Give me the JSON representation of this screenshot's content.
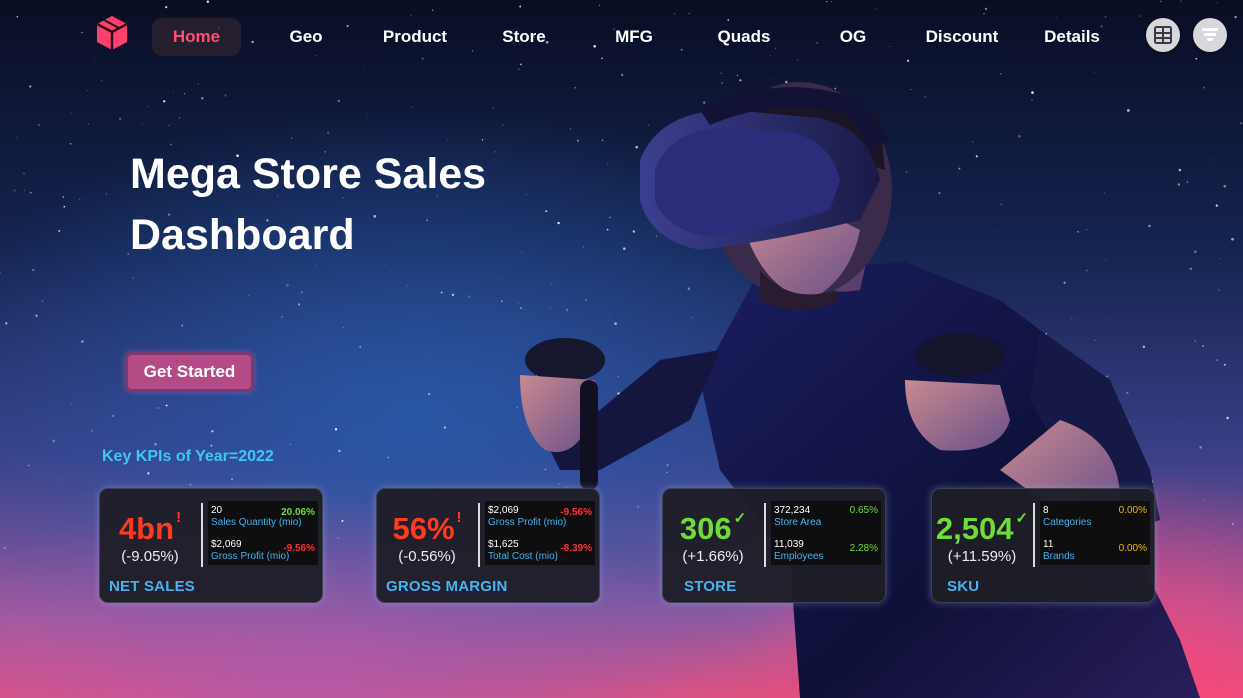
{
  "nav": {
    "items": [
      {
        "label": "Home",
        "active": true
      },
      {
        "label": "Geo"
      },
      {
        "label": "Product"
      },
      {
        "label": "Store"
      },
      {
        "label": "MFG"
      },
      {
        "label": "Quads"
      },
      {
        "label": "OG"
      },
      {
        "label": "Discount"
      },
      {
        "label": "Details"
      }
    ],
    "icons": [
      "cube-logo-icon",
      "table-grid-icon",
      "filter-funnel-icon"
    ]
  },
  "hero": {
    "title": "Mega Store Sales Dashboard",
    "cta_label": "Get Started"
  },
  "kpi_section": {
    "heading": "Key KPIs of Year=2022",
    "cards": [
      {
        "name": "NET SALES",
        "value": "4bn",
        "mark": "!",
        "change": "(-9.05%)",
        "rows": [
          {
            "value": "20",
            "label": "Sales Quantity (mio)",
            "pct": "20.06%"
          },
          {
            "value": "$2,069",
            "label": "Gross Profit (mio)",
            "pct": "-9.56%"
          }
        ]
      },
      {
        "name": "GROSS MARGIN",
        "value": "56%",
        "mark": "!",
        "change": "(-0.56%)",
        "rows": [
          {
            "value": "$2,069",
            "label": "Gross Profit (mio)",
            "pct": "-9.56%"
          },
          {
            "value": "$1,625",
            "label": "Total Cost (mio)",
            "pct": "-8.39%"
          }
        ]
      },
      {
        "name": "STORE",
        "value": "306",
        "mark": "✓",
        "change": "(+1.66%)",
        "rows": [
          {
            "value": "372,234",
            "label": "Store Area",
            "pct": "0.65%"
          },
          {
            "value": "11,039",
            "label": "Employees",
            "pct": "2.28%"
          }
        ]
      },
      {
        "name": "SKU",
        "value": "2,504",
        "mark": "✓",
        "change": "(+11.59%)",
        "rows": [
          {
            "value": "8",
            "label": "Categories",
            "pct": "0.00%"
          },
          {
            "value": "11",
            "label": "Brands",
            "pct": "0.00%"
          }
        ]
      }
    ]
  },
  "colors": {
    "accent_active": "#ff4d73",
    "kpi_negative": "#ff3b1f",
    "kpi_positive": "#6fdc3a",
    "pct_positive": "#6fdc3a",
    "pct_negative": "#ff3030",
    "pct_neutral": "#f0b400",
    "label_blue": "#46b4f0",
    "heading_blue": "#3fc6f2"
  }
}
